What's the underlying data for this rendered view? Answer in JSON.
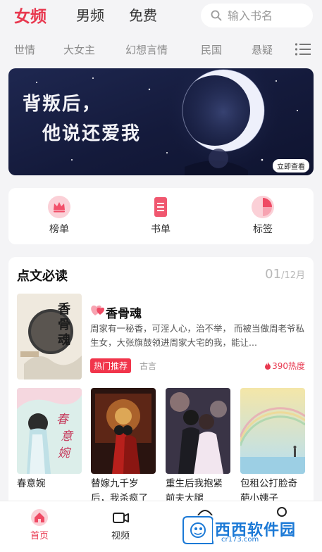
{
  "top_tabs": [
    {
      "label": "女频",
      "active": true
    },
    {
      "label": "男频"
    },
    {
      "label": "免费"
    }
  ],
  "search": {
    "placeholder": "输入书名",
    "icon": "search-icon"
  },
  "categories": [
    "世情",
    "大女主",
    "幻想言情",
    "民国",
    "悬疑"
  ],
  "banner": {
    "line1": "背叛后，",
    "line2": "他说还爱我",
    "button": "立即查看"
  },
  "quick_links": [
    {
      "label": "榜单",
      "icon": "crown-icon"
    },
    {
      "label": "书单",
      "icon": "booklist-icon"
    },
    {
      "label": "标签",
      "icon": "tag-icon"
    }
  ],
  "recommend": {
    "title": "点文必读",
    "date_day": "01",
    "date_month": "/12月",
    "featured": {
      "title": "香骨魂",
      "cover_text": "香骨魂",
      "desc": "周家有一秘香，可淫人心，治不举，   而被当做周老爷私生女，大张旗鼓领进周家大宅的我，能让...",
      "tag": "热门推荐",
      "category": "古言",
      "heat": "390热度"
    },
    "books": [
      {
        "title": "春意婉",
        "cover_text": "春意婉"
      },
      {
        "title": "替嫁九千岁后，我杀疯了"
      },
      {
        "title": "重生后我抱紧前夫大腿"
      },
      {
        "title": "包租公打脸奇葩小姨子"
      }
    ]
  },
  "bottom_nav": [
    {
      "label": "首页",
      "icon": "home-icon",
      "active": true
    },
    {
      "label": "视频",
      "icon": "video-icon"
    }
  ],
  "watermark": {
    "text": "西西软件园",
    "sub": "cr173.com"
  },
  "colors": {
    "accent": "#e8384f",
    "background": "#f4f4f6"
  }
}
